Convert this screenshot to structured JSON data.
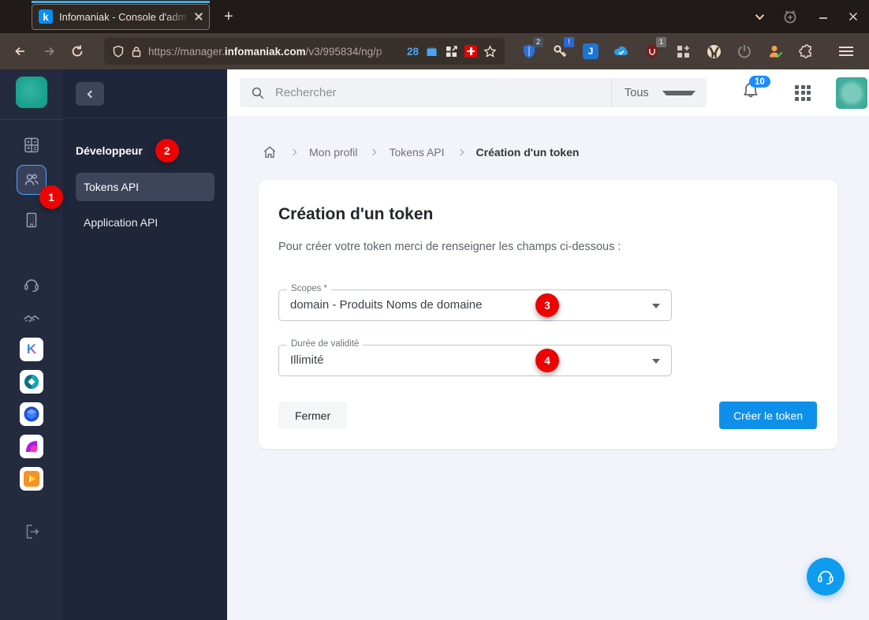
{
  "browser": {
    "tab_title": "Infomaniak - Console d'adm",
    "favicon_letter": "k",
    "new_tab_button": "+",
    "url": {
      "scheme_host": "https://manager.",
      "domain_bold": "infomaniak.com",
      "path": "/v3/995834/ng/p"
    },
    "container_tab_count": "28",
    "ext": {
      "badge_shield": "2",
      "badge_key": "!",
      "badge_ublock": "1",
      "letter_j": "J"
    }
  },
  "rail": {
    "badge": "1",
    "app_letter_k": "K"
  },
  "panel": {
    "heading": "Développeur",
    "badge": "2",
    "items": [
      {
        "label": "Tokens API"
      },
      {
        "label": "Application API"
      }
    ]
  },
  "topbar": {
    "search_placeholder": "Rechercher",
    "search_filter": "Tous",
    "notification_count": "10"
  },
  "breadcrumb": {
    "items": [
      "Mon profil",
      "Tokens API",
      "Création d'un token"
    ]
  },
  "card": {
    "title": "Création d'un token",
    "intro": "Pour créer votre token merci de renseigner les champs ci-dessous :",
    "fields": [
      {
        "label": "Scopes *",
        "value": "domain - Produits Noms de domaine",
        "badge": "3"
      },
      {
        "label": "Durée de validité",
        "value": "Illimité",
        "badge": "4"
      }
    ],
    "cancel_label": "Fermer",
    "submit_label": "Créer le token"
  },
  "colors": {
    "accent_blue": "#0e90ea",
    "annotation_red": "#ec0303",
    "brand_teal": "#16a08d"
  }
}
